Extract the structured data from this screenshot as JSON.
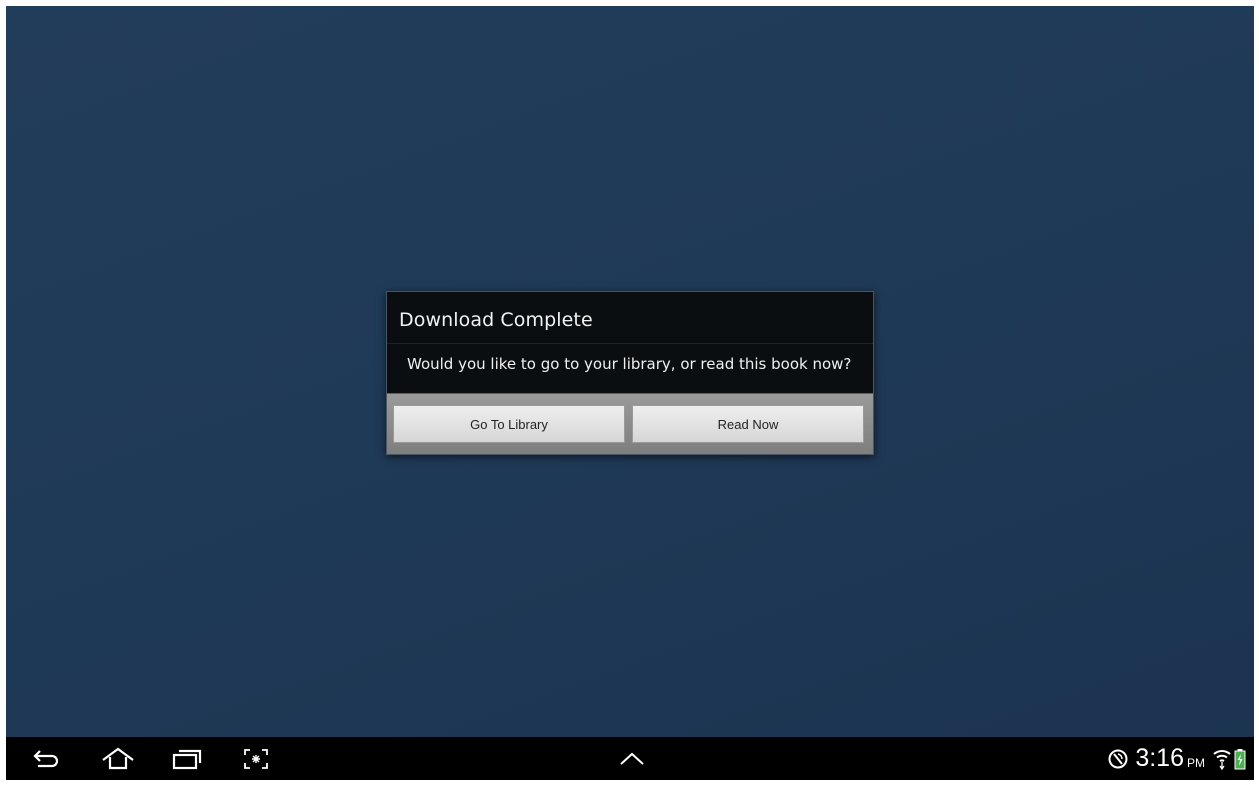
{
  "dialog": {
    "title": "Download Complete",
    "message": "Would you like to go to your library, or read this book now?",
    "buttons": {
      "go_to_library": "Go To Library",
      "read_now": "Read Now"
    }
  },
  "navbar": {
    "icons": [
      "back-icon",
      "home-icon",
      "recent-apps-icon",
      "screenshot-icon",
      "chevron-up-icon"
    ]
  },
  "status": {
    "time": "3:16",
    "ampm": "PM",
    "icons": [
      "sync-icon",
      "wifi-icon",
      "battery-charging-icon"
    ]
  },
  "colors": {
    "background": "#1f3a57",
    "dialog_background": "#0b0e11",
    "navbar": "#000000",
    "battery": "#4caf50"
  }
}
